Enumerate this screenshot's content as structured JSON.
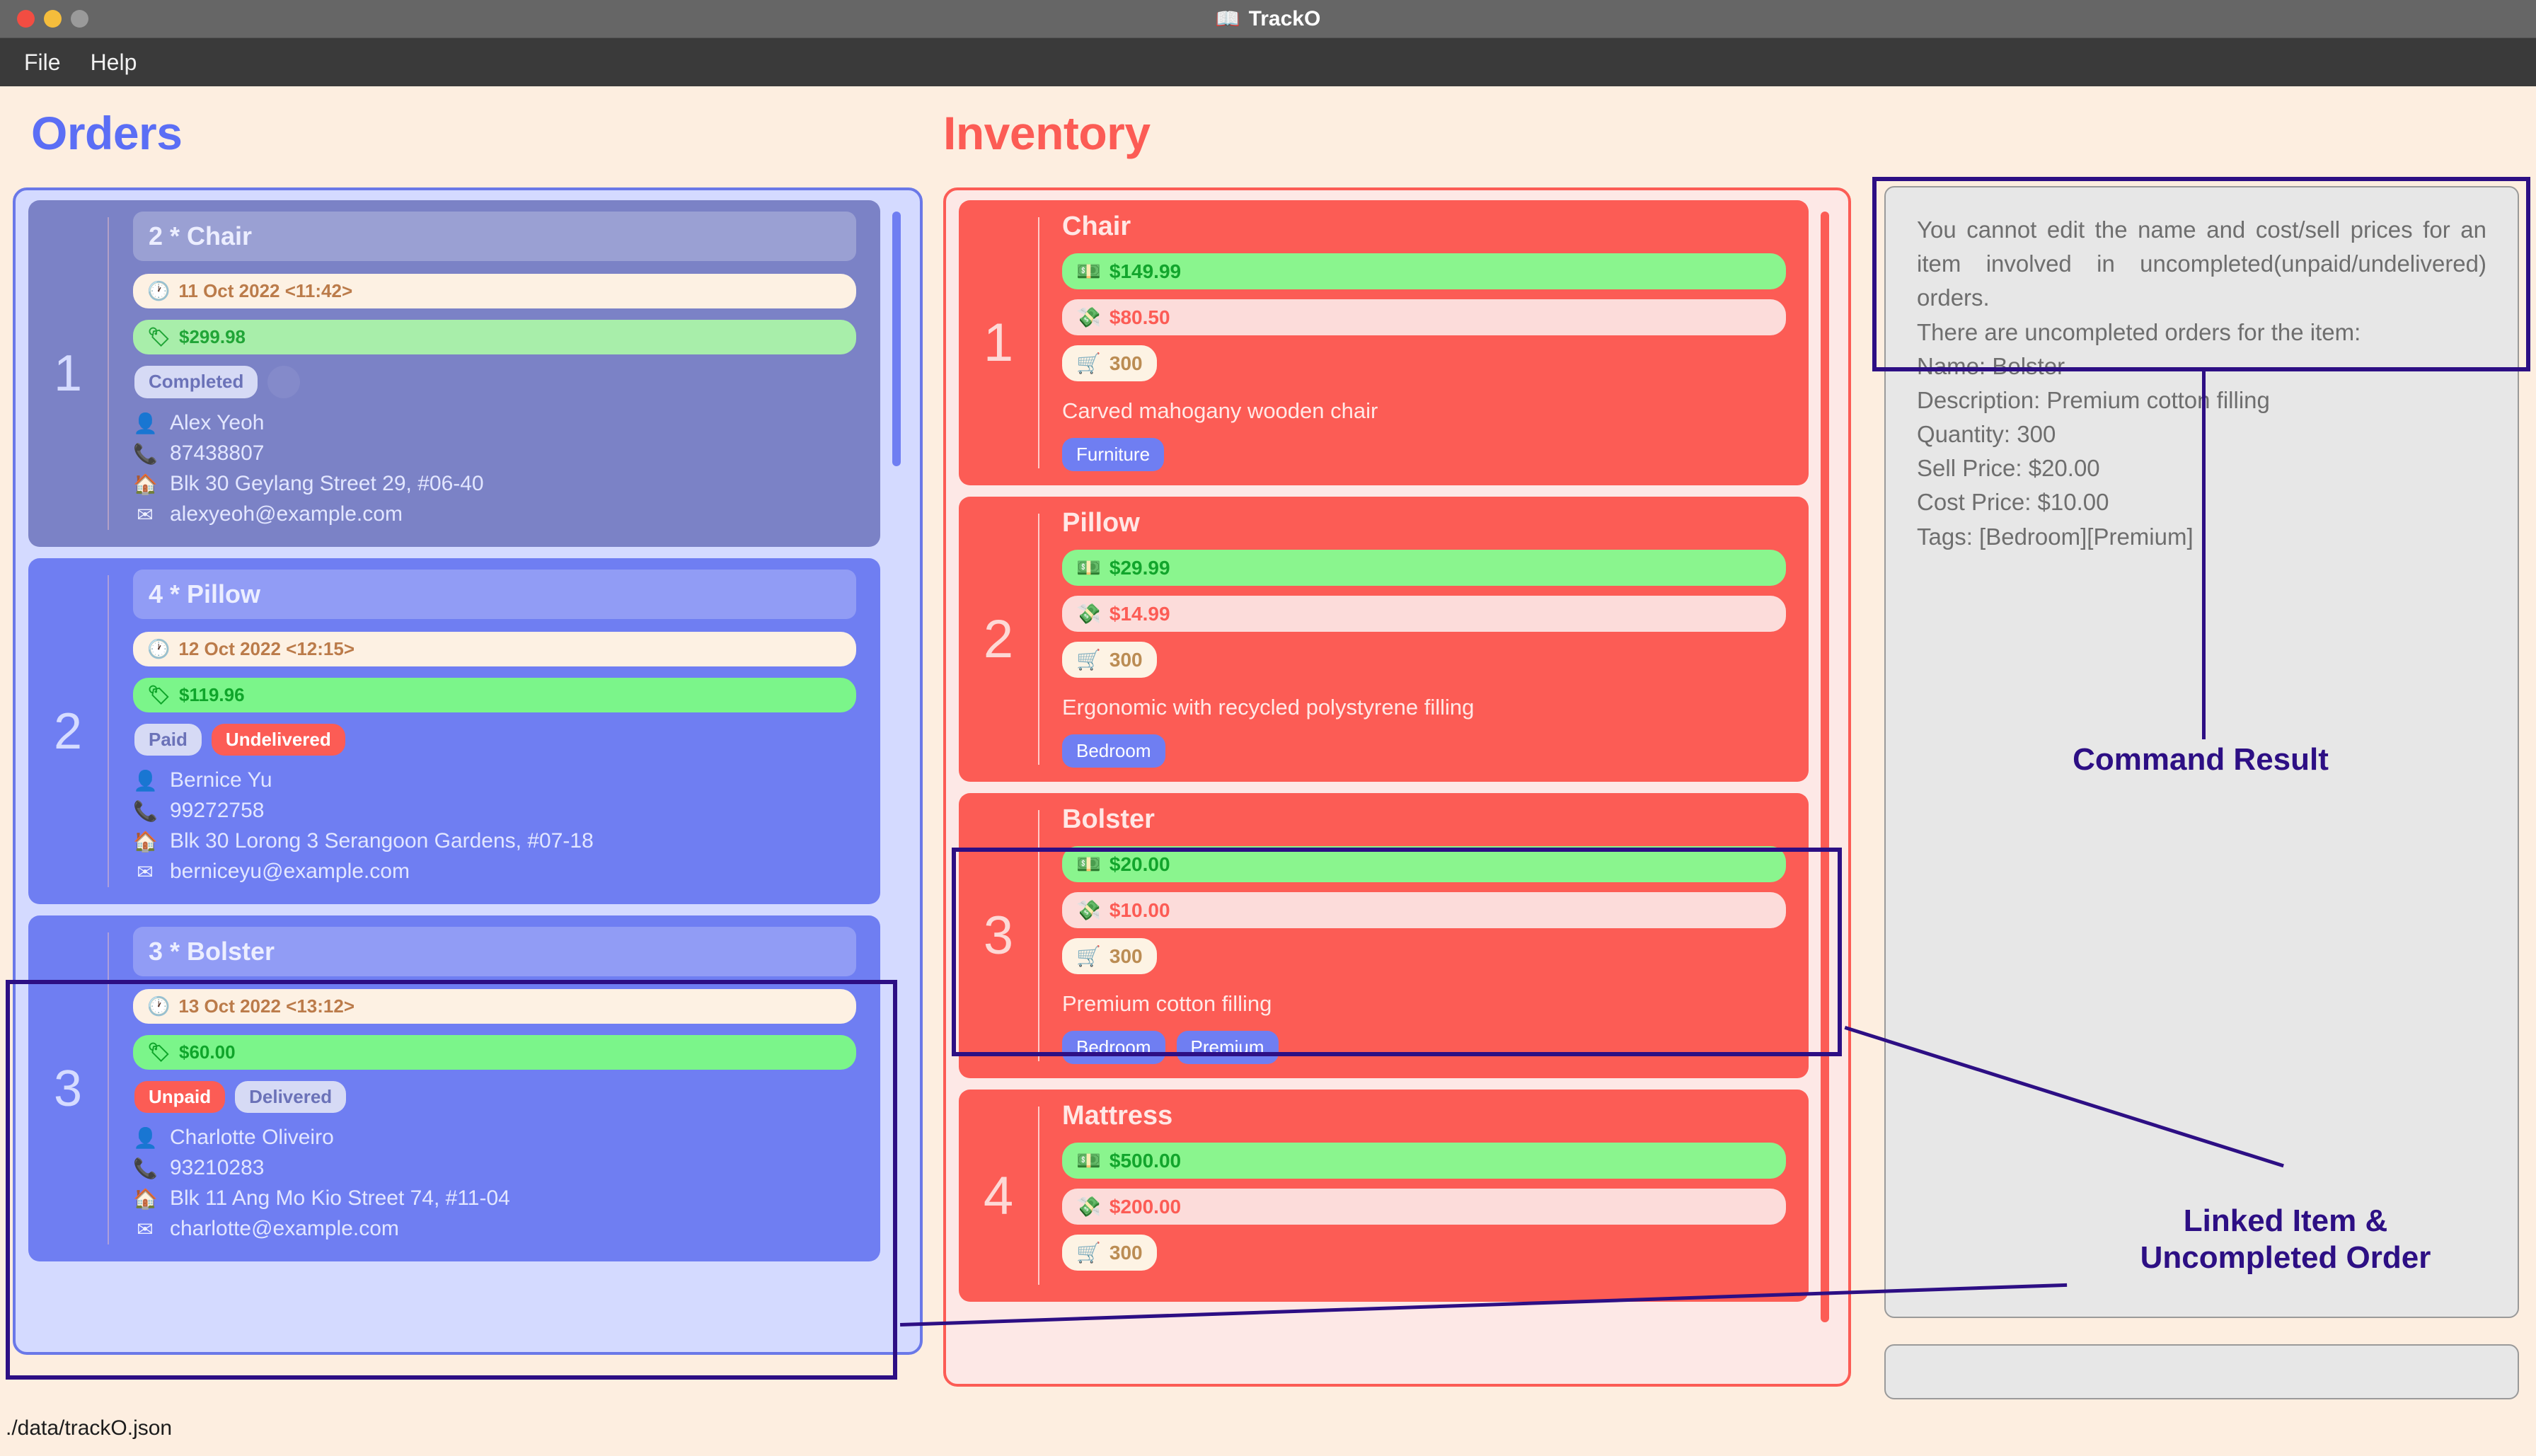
{
  "window": {
    "title": "TrackO",
    "title_icon": "book-icon",
    "buttons": [
      "close",
      "minimize",
      "maximize"
    ]
  },
  "menubar": {
    "items": [
      {
        "label": "File",
        "name": "menu-file"
      },
      {
        "label": "Help",
        "name": "menu-help"
      }
    ]
  },
  "headings": {
    "orders": "Orders",
    "inventory": "Inventory"
  },
  "colors": {
    "background": "#fdeee0",
    "orders_accent": "#5b6ef5",
    "inventory_accent": "#fc5c55",
    "annotation": "#2d0f84",
    "order_card": "#6f7ef2",
    "order_card_selected": "#7b82c6",
    "tag": "#6f7ef2",
    "sell_price": "#12a52c",
    "cost_price": "#fc5c55",
    "titlebar": "#666666",
    "menubar": "#3a3a3a"
  },
  "orders": [
    {
      "index": "1",
      "title": "2 * Chair",
      "date": "11 Oct 2022 <11:42>",
      "price": "$299.98",
      "badges": [
        {
          "label": "Completed",
          "style": "neutral"
        },
        {
          "label": "",
          "style": "ghost"
        }
      ],
      "name": "Alex Yeoh",
      "phone": "87438807",
      "address": "Blk 30 Geylang Street 29, #06-40",
      "email": "alexyeoh@example.com"
    },
    {
      "index": "2",
      "title": "4 * Pillow",
      "date": "12 Oct 2022 <12:15>",
      "price": "$119.96",
      "badges": [
        {
          "label": "Paid",
          "style": "neutral"
        },
        {
          "label": "Undelivered",
          "style": "danger"
        }
      ],
      "name": "Bernice Yu",
      "phone": "99272758",
      "address": "Blk 30 Lorong 3 Serangoon Gardens, #07-18",
      "email": "berniceyu@example.com"
    },
    {
      "index": "3",
      "title": "3 * Bolster",
      "date": "13 Oct 2022 <13:12>",
      "price": "$60.00",
      "badges": [
        {
          "label": "Unpaid",
          "style": "danger"
        },
        {
          "label": "Delivered",
          "style": "neutral"
        }
      ],
      "name": "Charlotte Oliveiro",
      "phone": "93210283",
      "address": "Blk 11 Ang Mo Kio Street 74, #11-04",
      "email": "charlotte@example.com"
    }
  ],
  "inventory": [
    {
      "index": "1",
      "name": "Chair",
      "sell_price": "$149.99",
      "cost_price": "$80.50",
      "quantity": "300",
      "description": "Carved mahogany wooden chair",
      "tags": [
        "Furniture"
      ]
    },
    {
      "index": "2",
      "name": "Pillow",
      "sell_price": "$29.99",
      "cost_price": "$14.99",
      "quantity": "300",
      "description": "Ergonomic with recycled polystyrene filling",
      "tags": [
        "Bedroom"
      ]
    },
    {
      "index": "3",
      "name": "Bolster",
      "sell_price": "$20.00",
      "cost_price": "$10.00",
      "quantity": "300",
      "description": "Premium cotton filling",
      "tags": [
        "Bedroom",
        "Premium"
      ]
    },
    {
      "index": "4",
      "name": "Mattress",
      "sell_price": "$500.00",
      "cost_price": "$200.00",
      "quantity": "300",
      "description": "",
      "tags": []
    }
  ],
  "result_panel": {
    "line1": "You cannot edit the name and cost/sell prices for an item involved in uncompleted(unpaid/undelivered) orders.",
    "line2": "There are uncompleted orders for the item:",
    "line3": "Name: Bolster",
    "line4": "Description: Premium cotton filling",
    "line5": "Quantity: 300",
    "line6": "Sell Price: $20.00",
    "line7": "Cost Price: $10.00",
    "line8": "Tags: [Bedroom][Premium]"
  },
  "command_box": {
    "value": "",
    "placeholder": ""
  },
  "annotations": {
    "command_result": "Command Result",
    "linked_item_line1": "Linked Item &",
    "linked_item_line2": "Uncompleted Order"
  },
  "statusbar": {
    "path": "./data/trackO.json"
  }
}
